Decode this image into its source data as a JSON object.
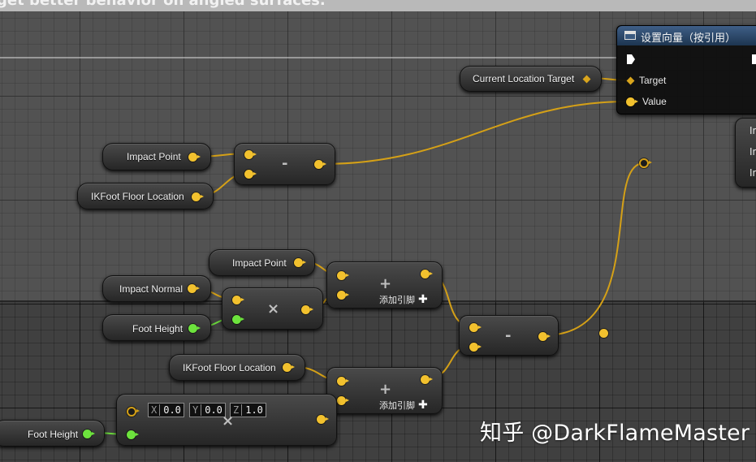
{
  "comment": {
    "title": "get better behavior on angled surfaces."
  },
  "nodes": {
    "current_location_target": {
      "label": "Current Location Target"
    },
    "impact_point_1": {
      "label": "Impact Point"
    },
    "ikfoot_floor_location_1": {
      "label": "IKFoot Floor Location"
    },
    "subtract_1": {
      "op": "-"
    },
    "impact_point_2": {
      "label": "Impact Point"
    },
    "impact_normal": {
      "label": "Impact Normal"
    },
    "foot_height_1": {
      "label": "Foot Height"
    },
    "multiply": {
      "op": "×"
    },
    "add_1": {
      "op": "+",
      "add_pin": "添加引脚"
    },
    "subtract_2": {
      "op": "-"
    },
    "ikfoot_floor_location_2": {
      "label": "IKFoot Floor Location"
    },
    "add_2": {
      "op": "+",
      "add_pin": "添加引脚"
    },
    "make_vector": {
      "op": "×",
      "x_axis": "X",
      "x_value": "0.0",
      "y_axis": "Y",
      "y_value": "0.0",
      "z_axis": "Z",
      "z_value": "1.0"
    },
    "foot_height_2": {
      "label": "Foot Height"
    },
    "set_vector": {
      "title": "设置向量（按引用）",
      "target_label": "Target",
      "value_label": "Value"
    },
    "partial_node": {
      "rows": [
        "In",
        "In",
        "In"
      ]
    }
  },
  "colors": {
    "vector_pin": "#f2c12e",
    "float_pin": "#6de33d",
    "wire": "#d4a017",
    "function_header": "#3f5f87"
  },
  "icons": [
    "exec-pin-icon",
    "function-icon",
    "add-pin-plus-icon",
    "diamond-pin-icon"
  ],
  "watermark": "知乎 @DarkFlameMaster"
}
